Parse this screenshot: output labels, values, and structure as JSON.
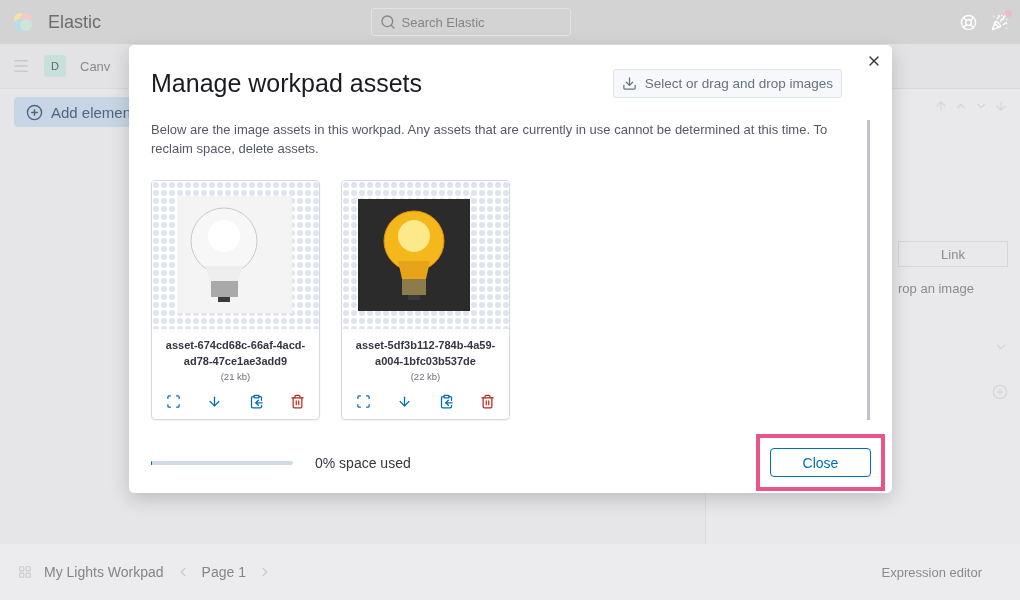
{
  "header": {
    "brand": "Elastic",
    "search": {
      "placeholder": "Search Elastic"
    }
  },
  "breadcrumb": {
    "avatar": "D",
    "label": "Canv"
  },
  "toolbar": {
    "add_button": "Add elemen"
  },
  "side_panel": {
    "tab": "Link",
    "drop_hint": "rop an image"
  },
  "footer": {
    "workpad": "My Lights Workpad",
    "page": "Page 1",
    "editor": "Expression editor"
  },
  "modal": {
    "title": "Manage workpad assets",
    "upload_button": "Select or drag and drop images",
    "description": "Below are the image assets in this workpad. Any assets that are currently in use cannot be determined at this time. To reclaim space, delete assets.",
    "assets": [
      {
        "name": "asset-674cd68c-66af-4acd-ad78-47ce1ae3add9",
        "size": "(21 kb)",
        "kind": "clear"
      },
      {
        "name": "asset-5df3b112-784b-4a59-a004-1bfc03b537de",
        "size": "(22 kb)",
        "kind": "lit"
      }
    ],
    "usage": {
      "level": 0.01,
      "label": "0% space used"
    },
    "close_button": "Close"
  }
}
